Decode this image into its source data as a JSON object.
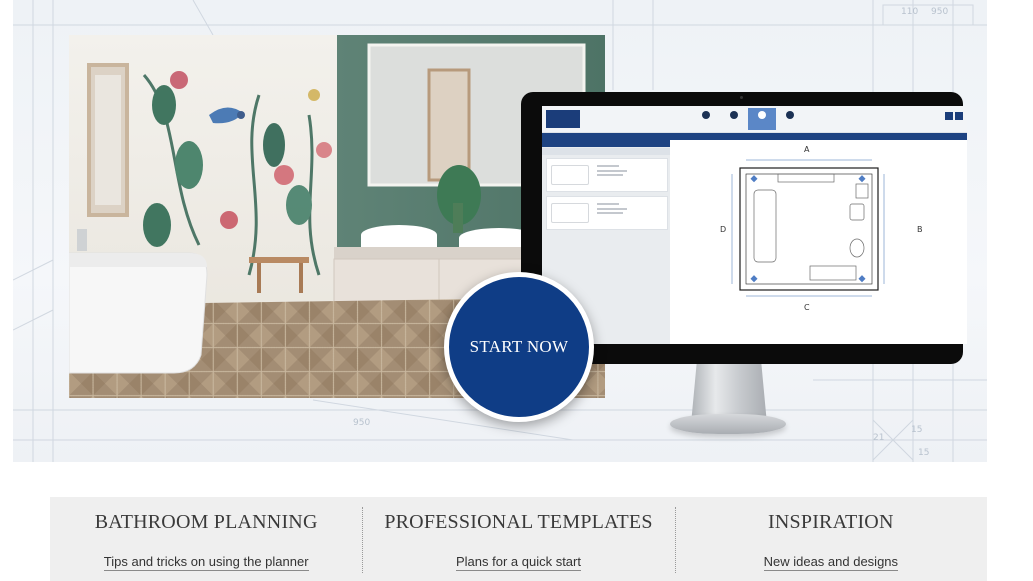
{
  "hero": {
    "start_button": "START NOW",
    "plan": {
      "label_top": "A",
      "label_right": "B",
      "label_bottom": "C",
      "label_left": "D"
    }
  },
  "panels": [
    {
      "title": "BATHROOM PLANNING",
      "link": "Tips and tricks on using the planner"
    },
    {
      "title": "PROFESSIONAL TEMPLATES",
      "link": "Plans for a quick start"
    },
    {
      "title": "INSPIRATION",
      "link": "New ideas and designs"
    }
  ],
  "colors": {
    "brand_blue": "#0f3d86",
    "app_bar": "#1e4382",
    "panel_bg": "#efefef"
  }
}
